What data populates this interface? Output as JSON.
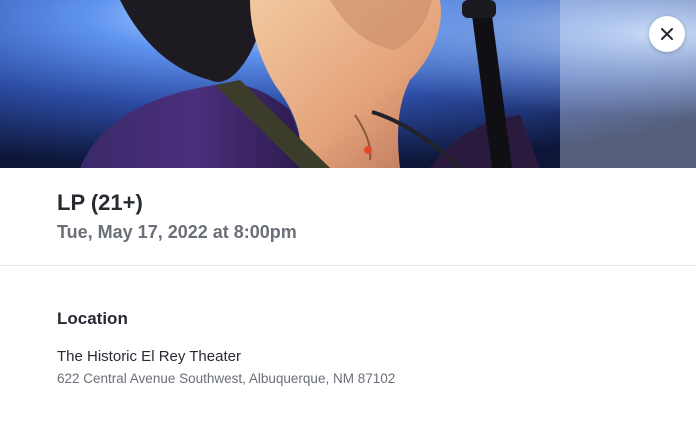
{
  "event": {
    "title": "LP (21+)",
    "datetime": "Tue, May 17, 2022 at 8:00pm"
  },
  "location": {
    "heading": "Location",
    "venue_name": "The Historic El Rey Theater",
    "venue_address": "622 Central Avenue Southwest, Albuquerque, NM 87102"
  },
  "icons": {
    "close": "close-icon"
  },
  "colors": {
    "title": "#262a33",
    "muted": "#6b6f78",
    "divider": "#e6e7ea",
    "stage_light": "#4f7fe0"
  }
}
